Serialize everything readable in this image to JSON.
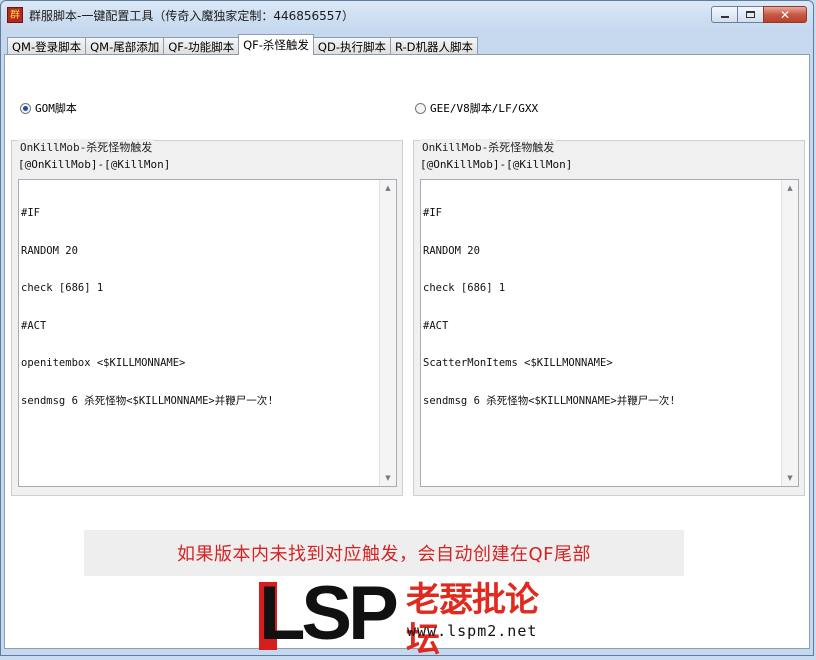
{
  "window": {
    "title": "群服脚本-一键配置工具（传奇入魔独家定制：446856557）",
    "icon_text": "群"
  },
  "tabs": [
    {
      "label": "QM-登录脚本",
      "active": false
    },
    {
      "label": "QM-尾部添加",
      "active": false
    },
    {
      "label": "QF-功能脚本",
      "active": false
    },
    {
      "label": "QF-杀怪触发",
      "active": true
    },
    {
      "label": "QD-执行脚本",
      "active": false
    },
    {
      "label": "R-D机器人脚本",
      "active": false
    }
  ],
  "radios": {
    "gom": {
      "label": "GOM脚本",
      "checked": true
    },
    "gee": {
      "label": "GEE/V8脚本/LF/GXX",
      "checked": false
    }
  },
  "left_group": {
    "title": "OnKillMob-杀死怪物触发",
    "label": "[@OnKillMob]-[@KillMon]",
    "lines": [
      "#IF",
      "RANDOM 20",
      "check [686] 1",
      "#ACT",
      "openitembox <$KILLMONNAME>",
      "sendmsg 6 杀死怪物<$KILLMONNAME>并鞭尸一次!"
    ]
  },
  "right_group": {
    "title": "OnKillMob-杀死怪物触发",
    "label": "[@OnKillMob]-[@KillMon]",
    "lines": [
      "#IF",
      "RANDOM 20",
      "check [686] 1",
      "#ACT",
      "ScatterMonItems <$KILLMONNAME>",
      "sendmsg 6 杀死怪物<$KILLMONNAME>并鞭尸一次!"
    ]
  },
  "notice": "如果版本内未找到对应触发，会自动创建在QF尾部",
  "logo": {
    "brand": "LSP",
    "forum": "老瑟批论坛",
    "url": "www.lspm2.net"
  },
  "colors": {
    "notice_text": "#d52323",
    "logo_red": "#d71e1e",
    "window_frame": "#c5d8ee"
  }
}
